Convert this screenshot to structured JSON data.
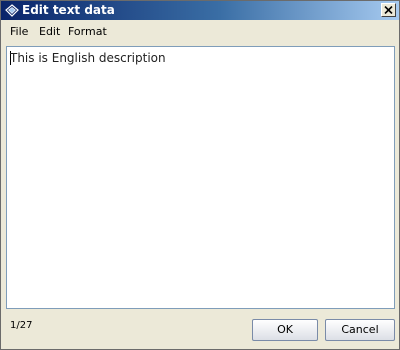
{
  "window": {
    "title": "Edit text data",
    "icon": "diamond-app-icon",
    "close_icon": "close-icon"
  },
  "menu": {
    "items": [
      {
        "label": "File"
      },
      {
        "label": "Edit"
      },
      {
        "label": "Format"
      }
    ]
  },
  "editor": {
    "text": "This is English description"
  },
  "status": {
    "position": "1/27"
  },
  "buttons": {
    "ok": "OK",
    "cancel": "Cancel"
  },
  "colors": {
    "title_gradient_start": "#0a246a",
    "title_gradient_end": "#a6caf0",
    "window_bg": "#ece9d8",
    "editor_border": "#7f9db9"
  }
}
